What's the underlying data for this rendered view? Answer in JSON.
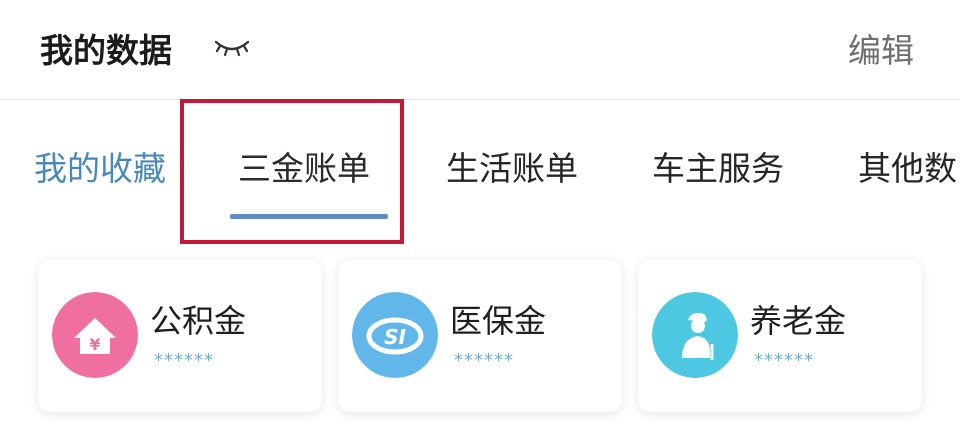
{
  "header": {
    "title": "我的数据",
    "edit_label": "编辑"
  },
  "tabs": {
    "favorites_label": "我的收藏",
    "items": [
      "三金账单",
      "生活账单",
      "车主服务",
      "其他数"
    ],
    "selected_index": 0
  },
  "cards": [
    {
      "label": "公积金",
      "value": "******",
      "icon": "house-yen-icon",
      "color": "#f06fa1"
    },
    {
      "label": "医保金",
      "value": "******",
      "icon": "si-logo-icon",
      "color": "#62b7ea"
    },
    {
      "label": "养老金",
      "value": "******",
      "icon": "elderly-person-icon",
      "color": "#4ec7e2"
    }
  ],
  "colors": {
    "accent": "#5b8ec0",
    "favorites": "#4a88b8",
    "highlight_box": "#c3183a"
  }
}
